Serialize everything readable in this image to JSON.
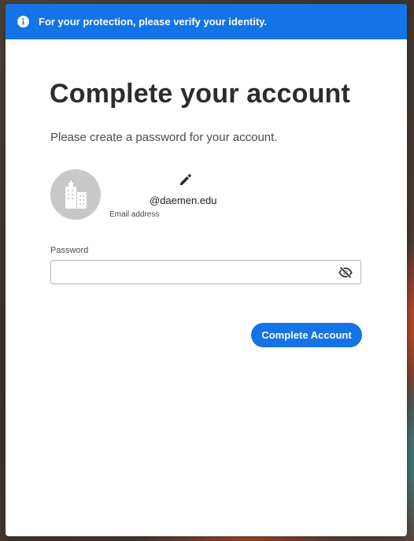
{
  "banner": {
    "icon": "info-icon",
    "text": "For your protection, please verify your identity."
  },
  "page": {
    "title": "Complete your account",
    "subtitle": "Please create a password for your account."
  },
  "account": {
    "avatar_icon": "building-icon",
    "edit_icon": "pencil-icon",
    "email": "@daemen.edu",
    "email_label": "Email address"
  },
  "password": {
    "label": "Password",
    "value": "",
    "toggle_icon": "eye-slash-icon"
  },
  "actions": {
    "complete_label": "Complete Account"
  },
  "colors": {
    "accent": "#1473e6",
    "avatar_bg": "#c8c8c8",
    "title": "#2c2c2c"
  }
}
